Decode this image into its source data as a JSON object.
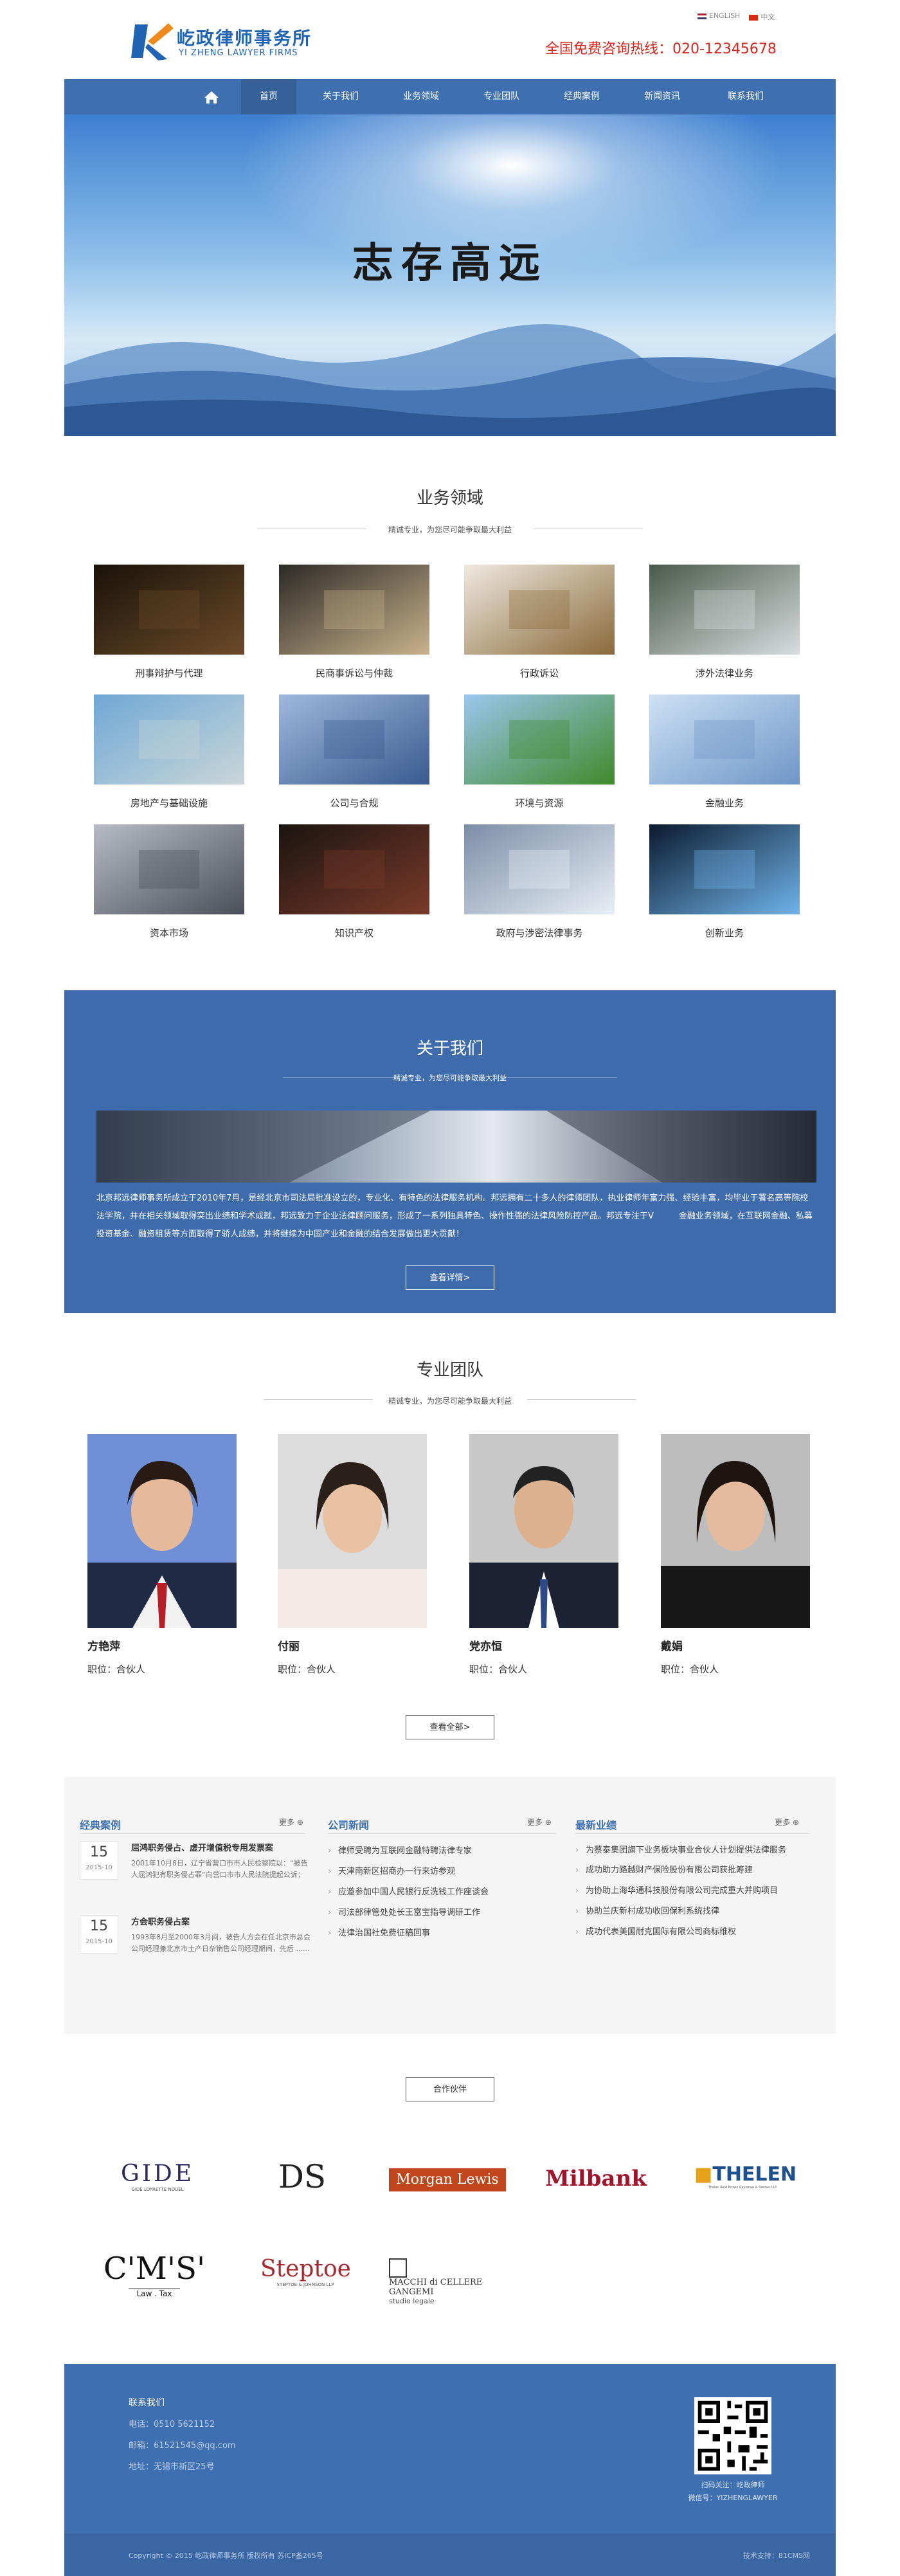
{
  "header": {
    "logo_cn": "屹政律师事务所",
    "logo_en": "YI ZHENG LAWYER FIRMS",
    "lang_en": "ENGLISH",
    "lang_cn": "中文",
    "hotline": "全国免费咨询热线：020-12345678"
  },
  "nav": {
    "items": [
      "首页",
      "关于我们",
      "业务领域",
      "专业团队",
      "经典案例",
      "新闻资讯",
      "联系我们"
    ]
  },
  "hero": {
    "text": "志存高远"
  },
  "services": {
    "title": "业务领域",
    "subtitle": "精诚专业，为您尽可能争取最大利益",
    "items": [
      "刑事辩护与代理",
      "民商事诉讼与仲裁",
      "行政诉讼",
      "涉外法律业务",
      "房地产与基础设施",
      "公司与合规",
      "环境与资源",
      "金融业务",
      "资本市场",
      "知识产权",
      "政府与涉密法律事务",
      "创新业务"
    ]
  },
  "about": {
    "title": "关于我们",
    "subtitle": "精诚专业，为您尽可能争取最大利益",
    "text": "北京邦远律师事务所成立于2010年7月，是经北京市司法局批准设立的，专业化、有特色的法律服务机构。邦远拥有二十多人的律师团队，执业律师年富力强、经验丰富，均毕业于著名高等院校法学院，并在相关领域取得突出业绩和学术成就，邦远致力于企业法律顾问服务，形成了一系列独具特色、操作性强的法律风险防控产品。邦远专注于V　　　金融业务领域，在互联网金融、私募投资基金、融资租赁等方面取得了骄人成绩，并将继续为中国产业和金融的结合发展做出更大贡献！",
    "button": "查看详情>"
  },
  "team": {
    "title": "专业团队",
    "subtitle": "精诚专业，为您尽可能争取最大利益",
    "members": [
      {
        "name": "方艳萍",
        "role": "职位：合伙人"
      },
      {
        "name": "付丽",
        "role": "职位：合伙人"
      },
      {
        "name": "党亦恒",
        "role": "职位：合伙人"
      },
      {
        "name": "戴娟",
        "role": "职位：合伙人"
      }
    ],
    "button": "查看全部>"
  },
  "news": {
    "cases_title": "经典案例",
    "news_title": "公司新闻",
    "perf_title": "最新业绩",
    "more": "更多",
    "cases": [
      {
        "day": "15",
        "ym": "2015-10",
        "title": "屈鸿职务侵占、虚开增值税专用发票案",
        "desc": "2001年10月8日，辽宁省营口市市人民检察院以：“被告人屈鸿犯有职务侵占罪”向营口市市人民法院提起公诉；"
      },
      {
        "day": "15",
        "ym": "2015-10",
        "title": "方会职务侵占案",
        "desc": "1993年8月至2000年3月间，被告人方会在任北京市总会公司经理兼北京市土产日杂销售公司经理期间，先后 ......"
      }
    ],
    "news_items": [
      "律师受聘为互联网金融特聘法律专家",
      "天津南新区招商办一行来访参观",
      "应邀参加中国人民银行反洗钱工作座谈会",
      "司法部律管处处长王富宝指导调研工作",
      "法律治国社免费征稿回事"
    ],
    "perf_items": [
      "为蔡泰集团旗下业务板块事业合伙人计划提供法律服务",
      "成功助力路越财产保险股份有限公司获批筹建",
      "为协助上海华通科技股份有限公司完成重大并购项目",
      "协助兰庆新村成功收回保利系统找律",
      "成功代表美国耐克国际有限公司商标维权"
    ]
  },
  "partners": {
    "button": "合作伙伴",
    "logos": [
      "GIDE",
      "GIDE LOYRETTE NOUEL",
      "DS",
      "Morgan Lewis",
      "Milbank",
      "THELEN",
      "Thelen Reid Brown Raysman & Steiner LLP",
      "C'M'S'",
      "Law . Tax",
      "Steptoe",
      "STEPTOE & JOHNSON LLP",
      "MACCHI di CELLERE GANGEMI",
      "studio legale"
    ]
  },
  "footer": {
    "contact_title": "联系我们",
    "phone": "电话：0510 5621152",
    "email": "邮箱：61521545@qq.com",
    "address": "地址：无锡市新区25号",
    "qr_caption_1": "扫码关注：屹政律师",
    "qr_caption_2": "微信号：YIZHENGLAWYER",
    "copyright": "Copyright © 2015 屹政律师事务所 版权所有  苏ICP备265号",
    "support": "技术支持：81CMS网"
  },
  "colors": {
    "brand_blue": "#3e6fb0",
    "hotline_red": "#d9261c"
  }
}
